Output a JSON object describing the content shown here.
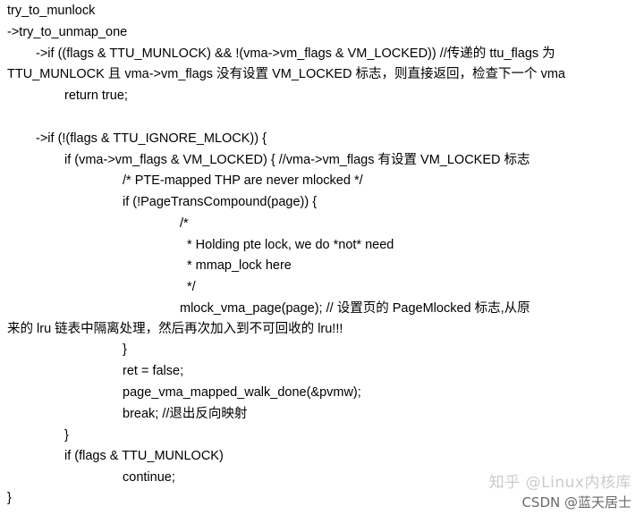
{
  "lines": [
    "try_to_munlock",
    "->try_to_unmap_one",
    "->if ((flags & TTU_MUNLOCK) && !(vma->vm_flags & VM_LOCKED))    //传递的 ttu_flags 为",
    "TTU_MUNLOCK 且 vma->vm_flags 没有设置 VM_LOCKED 标志，则直接返回，检查下一个 vma",
    "return true;",
    "->if (!(flags & TTU_IGNORE_MLOCK)) {",
    "if (vma->vm_flags & VM_LOCKED) {      //vma->vm_flags 有设置 VM_LOCKED 标志",
    "/* PTE-mapped THP are never mlocked */",
    "if (!PageTransCompound(page)) {",
    "/*",
    "* Holding pte lock, we do *not* need",
    "* mmap_lock here",
    "*/",
    "mlock_vma_page(page);        //  设置页的 PageMlocked 标志,从原",
    "来的 lru 链表中隔离处理，然后再次加入到不可回收的 lru!!!",
    "}",
    "ret = false;",
    "page_vma_mapped_walk_done(&pvmw);",
    "break;        //退出反向映射",
    "}",
    "if (flags & TTU_MUNLOCK)",
    "continue;",
    "}"
  ],
  "watermark": {
    "zhihu": "知乎 @Linux内核库",
    "csdn": "CSDN @蓝天居士"
  }
}
